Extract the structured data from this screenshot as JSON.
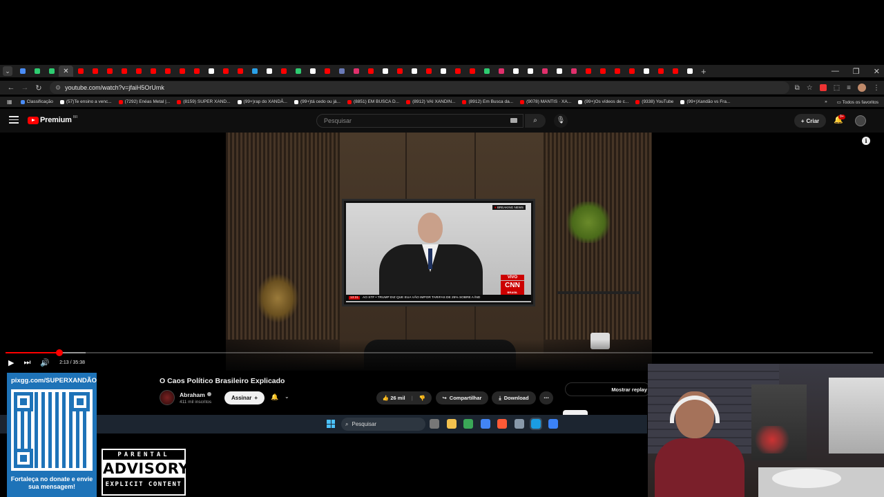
{
  "browser": {
    "tabs_count": 52,
    "tab_favicon_colors": [
      "#4a8df8",
      "#2ecc71",
      "#2ecc71",
      "#ff0000",
      "#ff0000",
      "#ff0000",
      "#ff0000",
      "#ff0000",
      "#ff0000",
      "#ff0000",
      "#ff0000",
      "#ff0000",
      "#ff0000",
      "#ffffff",
      "#ff0000",
      "#ff0000",
      "#2aa1e8",
      "#ffffff",
      "#ff0000",
      "#2ecc71",
      "#ffffff",
      "#ff0000",
      "#6a7ab8",
      "#e1306c",
      "#ff0000",
      "#ffffff",
      "#ff0000",
      "#ffffff",
      "#ff0000",
      "#ffffff",
      "#ff0000",
      "#ff0000",
      "#2ecc71",
      "#e1306c",
      "#ffffff",
      "#ffffff",
      "#e1306c",
      "#ffffff",
      "#e1306c",
      "#ff0000",
      "#ff0000",
      "#ff0000",
      "#ff0000",
      "#ffffff",
      "#ff0000",
      "#ff0000",
      "#ffffff"
    ],
    "url": "youtube.com/watch?v=jfaiH5OrUmk",
    "bookmarks": [
      {
        "label": "Classificação",
        "color": "#4a8df8"
      },
      {
        "label": "(57)Te ensino a venc...",
        "color": "#ffffff"
      },
      {
        "label": "(7292) Enéas Metal |...",
        "color": "#ff0000"
      },
      {
        "label": "(8159) SUPER XAND...",
        "color": "#ff0000"
      },
      {
        "label": "(99+)rap do XANDÃ...",
        "color": "#ffffff"
      },
      {
        "label": "(99+)tá cedo ou já...",
        "color": "#ffffff"
      },
      {
        "label": "(8851) EM BUSCA D...",
        "color": "#ff0000"
      },
      {
        "label": "(8912) VAI XANDIN...",
        "color": "#ff0000"
      },
      {
        "label": "(8912) Em Busca da...",
        "color": "#ff0000"
      },
      {
        "label": "(9078) MANTIS · XA...",
        "color": "#ff0000"
      },
      {
        "label": "(99+)Os vídeos de c...",
        "color": "#ffffff"
      },
      {
        "label": "(9338) YouTube",
        "color": "#ff0000"
      },
      {
        "label": "(99+)Xandão vs Fra...",
        "color": "#ffffff"
      }
    ],
    "bookmarks_more": "»",
    "all_bookmarks": "Todos os favoritos"
  },
  "yt": {
    "logo_text": "Premium",
    "country_code": "BR",
    "search_placeholder": "Pesquisar",
    "create_label": "Criar",
    "notif_badge": "9+"
  },
  "video": {
    "breaking": "BREAKING NEWS",
    "live": "VIVO",
    "cnn": "CNN",
    "cnn_sub": "BRASIL",
    "ticker_time": "13:31",
    "ticker_text": "AO STF  •  TRUMP DIZ QUE EUA VÃO IMPOR TARIFAS DE 25% SOBRE A ÍND",
    "time_display": "2:13 / 35:38",
    "played_fraction": 0.062,
    "buffered_fraction": 0.092
  },
  "meta": {
    "title": "O Caos Político Brasileiro Explicado",
    "channel": "Abraham",
    "subs": "411 mil inscritos",
    "subscribe": "Assinar",
    "likes": "26 mil",
    "share": "Compartilhar",
    "download": "Download",
    "more": "⋯",
    "replay": "Mostrar replay"
  },
  "taskbar": {
    "search": "Pesquisar",
    "app_colors": [
      "#777777",
      "#f2c14e",
      "#3aa757",
      "#4285f4",
      "#ff5a36",
      "#8899aa",
      "#1b9de2",
      "#3b82f6"
    ]
  },
  "overlay": {
    "donate_url": "pixgg.com/SUPERXANDÃO",
    "donate_msg": "Fortaleça no donate e envie sua mensagem!",
    "adv_top": "PARENTAL",
    "adv_mid": "ADVISORY",
    "adv_bot": "EXPLICIT CONTENT"
  }
}
